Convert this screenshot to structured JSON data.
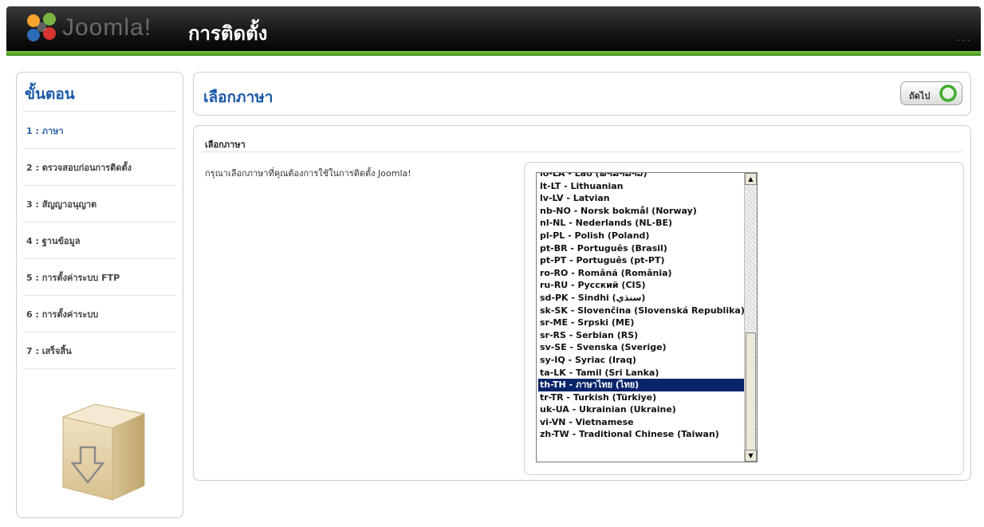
{
  "header": {
    "brand": "Joomla!",
    "title": "การติดตั้ง",
    "right_text": "· · ·"
  },
  "sidebar": {
    "title": "ขั้นตอน",
    "steps": [
      {
        "label": "1 : ภาษา",
        "active": true
      },
      {
        "label": "2 : ตรวจสอบก่อนการติดตั้ง",
        "active": false
      },
      {
        "label": "3 : สัญญาอนุญาต",
        "active": false
      },
      {
        "label": "4 : ฐานข้อมูล",
        "active": false
      },
      {
        "label": "5 : การตั้งค่าระบบ FTP",
        "active": false
      },
      {
        "label": "6 : การตั้งค่าระบบ",
        "active": false
      },
      {
        "label": "7 : เสร็จสิ้น",
        "active": false
      }
    ]
  },
  "main": {
    "title": "เลือกภาษา",
    "next_label": "ถัดไป",
    "section_title": "เลือกภาษา",
    "instruction": "กรุณาเลือกภาษาที่คุณต้องการใช้ในการติดตั้ง Joomla!"
  },
  "languages": {
    "items": [
      "lo-LA - Lao (ພາສາລາວ)",
      "lt-LT - Lithuanian",
      "lv-LV - Latvian",
      "nb-NO - Norsk bokmål (Norway)",
      "nl-NL - Nederlands (NL-BE)",
      "pl-PL - Polish (Poland)",
      "pt-BR - Português (Brasil)",
      "pt-PT - Português (pt-PT)",
      "ro-RO - Română (România)",
      "ru-RU - Русский (CIS)",
      "sd-PK - Sindhi (سنڌي)",
      "sk-SK - Slovenčina (Slovenská Republika)",
      "sr-ME - Srpski (ME)",
      "sr-RS - Serbian (RS)",
      "sv-SE - Svenska (Sverige)",
      "sy-IQ - Syriac (Iraq)",
      "ta-LK - Tamil (Sri Lanka)",
      "th-TH - ภาษาไทย (ไทย)",
      "tr-TR - Turkish (Türkiye)",
      "uk-UA - Ukrainian (Ukraine)",
      "vi-VN - Vietnamese",
      "zh-TW - Traditional Chinese (Taiwan)"
    ],
    "selected_index": 17,
    "selection_color": "#0a246a"
  },
  "colors": {
    "accent_blue": "#1a5aa8",
    "header_green": "#5ea82f"
  },
  "icons": {
    "logo": "joomla-logo-icon",
    "next": "green-circle-arrow-icon",
    "box": "install-box-icon"
  }
}
